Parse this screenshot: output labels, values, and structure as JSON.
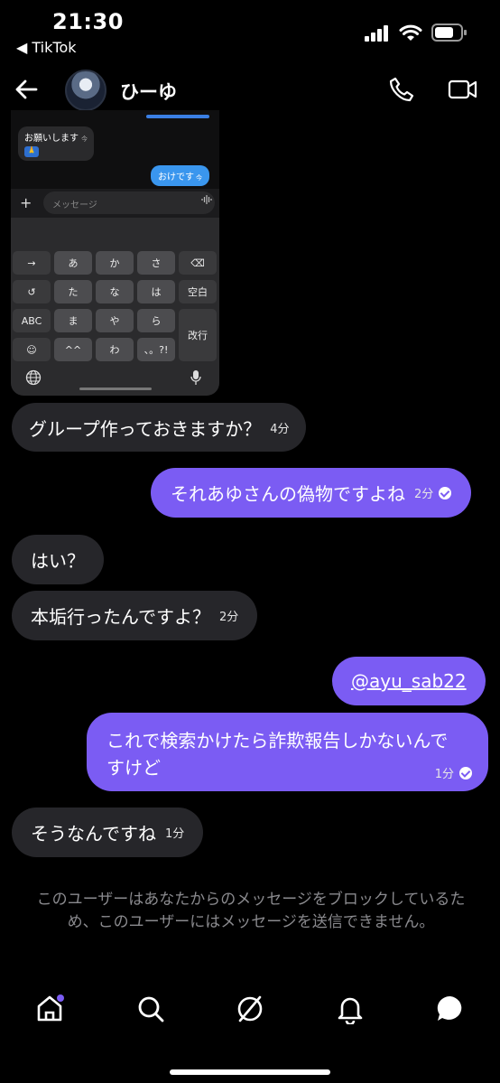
{
  "status_bar": {
    "time": "21:30",
    "back_app": "◀ TikTok"
  },
  "header": {
    "name": "ひーゆ"
  },
  "embedded_screenshot": {
    "incoming": "お願いします",
    "incoming_seen": "今",
    "outgoing": "おけです",
    "outgoing_seen": "今",
    "input_placeholder": "メッセージ",
    "keys": {
      "row1": [
        "→",
        "あ",
        "か",
        "さ",
        "⌫"
      ],
      "row2": [
        "↺",
        "た",
        "な",
        "は",
        "空白"
      ],
      "row3": [
        "ABC",
        "ま",
        "や",
        "ら",
        "改行"
      ],
      "row4": [
        "☺",
        "^^",
        "わ",
        "、。?!"
      ]
    }
  },
  "messages": [
    {
      "text": "グループ作っておきますか？",
      "time": "4分"
    },
    {
      "text": "それあゆさんの偽物ですよね",
      "time": "2分"
    },
    {
      "text": "はい？"
    },
    {
      "text": "本垢行ったんですよ？",
      "time": "2分"
    },
    {
      "text": "@ayu_sab22"
    },
    {
      "text_line1": "これで検索かけたら詐欺報告しかないんで",
      "text_line2": "すけど",
      "time": "1分"
    },
    {
      "text": "そうなんですね",
      "time": "1分"
    }
  ],
  "notice": "このユーザーはあなたからのメッセージをブロックしているため、このユーザーにはメッセージを送信できません。",
  "colors": {
    "accent": "#7b5cf3",
    "bubble_in": "#26262a",
    "notification_dot": "#7b5cf3"
  },
  "tabs": [
    "home-icon",
    "search-icon",
    "explore-icon",
    "bell-icon",
    "chat-icon"
  ]
}
